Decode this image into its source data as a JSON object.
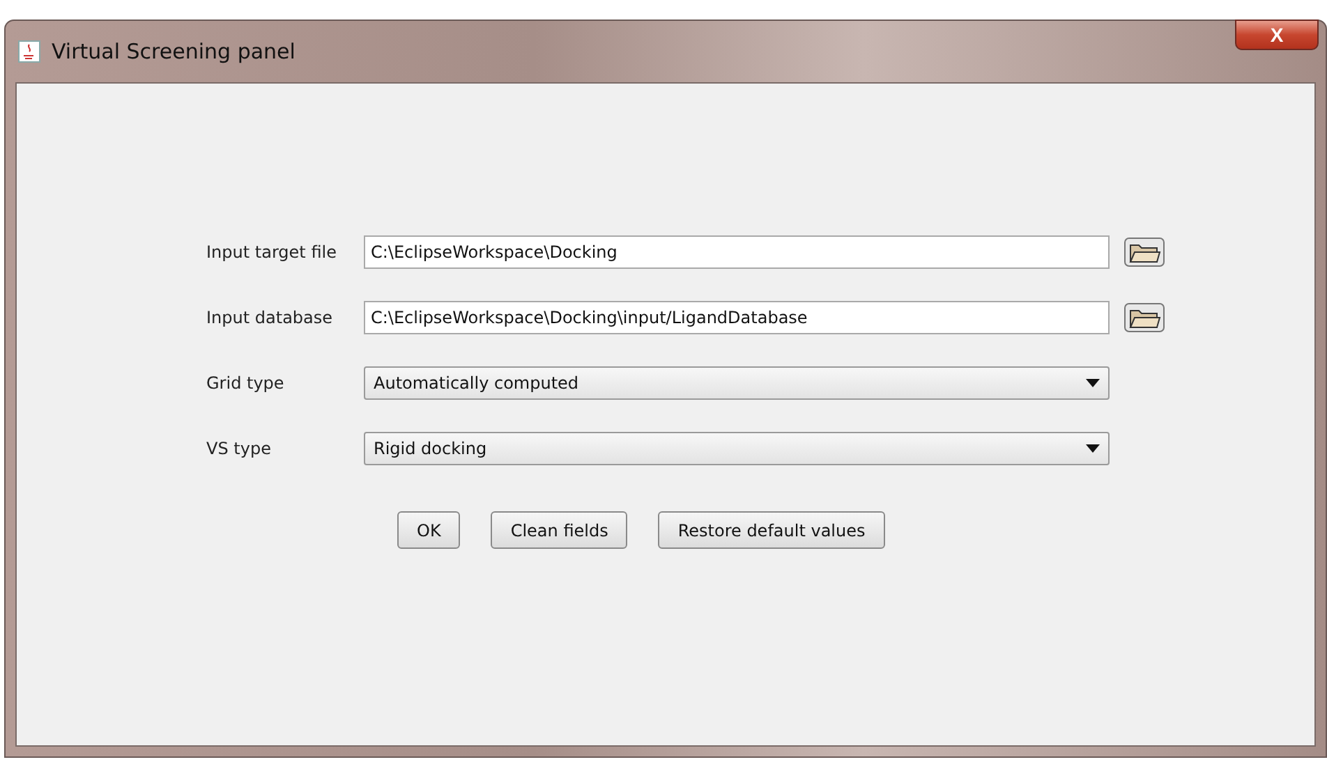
{
  "window": {
    "title": "Virtual Screening panel",
    "close_label": "X"
  },
  "fields": [
    {
      "kind": "file",
      "label": "Input target file",
      "value": "C:\\EclipseWorkspace\\Docking"
    },
    {
      "kind": "file",
      "label": "Input database",
      "value": "C:\\EclipseWorkspace\\Docking\\input/LigandDatabase"
    },
    {
      "kind": "select",
      "label": "Grid type",
      "value": "Automatically computed"
    },
    {
      "kind": "select",
      "label": "VS type",
      "value": "Rigid docking"
    }
  ],
  "buttons": [
    "OK",
    "Clean fields",
    "Restore default values"
  ]
}
